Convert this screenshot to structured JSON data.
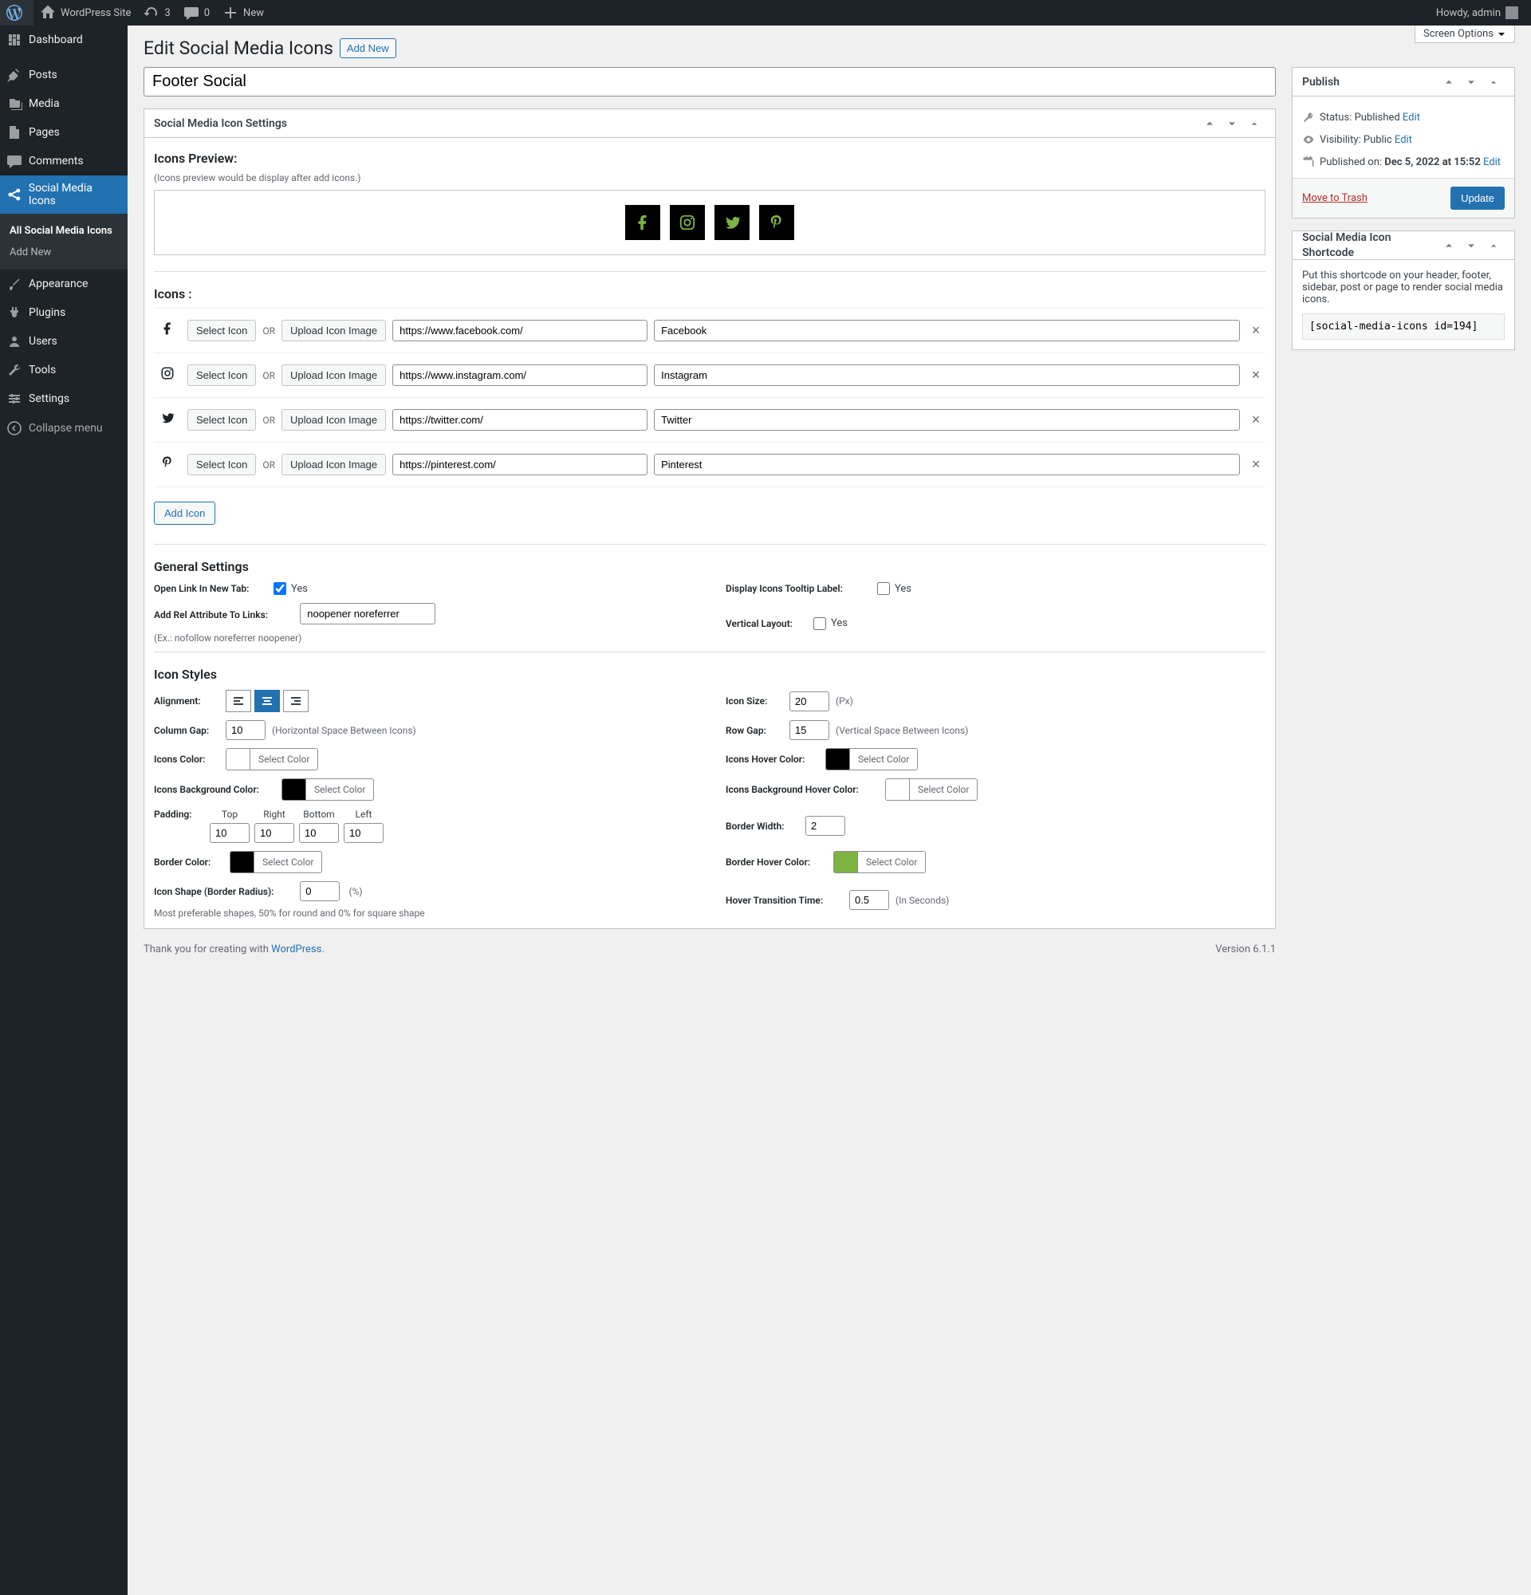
{
  "adminbar": {
    "site_name": "WordPress Site",
    "updates": "3",
    "comments": "0",
    "new": "New",
    "howdy": "Howdy, admin"
  },
  "sidebar": {
    "items": [
      {
        "label": "Dashboard"
      },
      {
        "label": "Posts"
      },
      {
        "label": "Media"
      },
      {
        "label": "Pages"
      },
      {
        "label": "Comments"
      },
      {
        "label": "Social Media Icons"
      },
      {
        "label": "Appearance"
      },
      {
        "label": "Plugins"
      },
      {
        "label": "Users"
      },
      {
        "label": "Tools"
      },
      {
        "label": "Settings"
      }
    ],
    "submenu": {
      "all": "All Social Media Icons",
      "add": "Add New"
    },
    "collapse": "Collapse menu"
  },
  "page": {
    "screen_options": "Screen Options",
    "heading": "Edit Social Media Icons",
    "add_new": "Add New",
    "title_value": "Footer Social"
  },
  "settings_panel": {
    "header": "Social Media Icon Settings",
    "preview_heading": "Icons Preview:",
    "preview_hint": "(Icons preview would be display after add icons.)",
    "icons_heading": "Icons :",
    "select_icon": "Select Icon",
    "or": "OR",
    "upload": "Upload Icon Image",
    "add_icon": "Add Icon",
    "rows": [
      {
        "icon": "facebook",
        "url": "https://www.facebook.com/",
        "title": "Facebook"
      },
      {
        "icon": "instagram",
        "url": "https://www.instagram.com/",
        "title": "Instagram"
      },
      {
        "icon": "twitter",
        "url": "https://twitter.com/",
        "title": "Twitter"
      },
      {
        "icon": "pinterest",
        "url": "https://pinterest.com/",
        "title": "Pinterest"
      }
    ]
  },
  "general": {
    "heading": "General Settings",
    "open_new_tab_label": "Open Link In New Tab:",
    "rel_label": "Add Rel Attribute To Links:",
    "rel_value": "noopener noreferrer",
    "rel_hint": "(Ex.: nofollow noreferrer noopener)",
    "tooltip_label": "Display Icons Tooltip Label:",
    "vertical_label": "Vertical Layout:",
    "yes": "Yes"
  },
  "styles": {
    "heading": "Icon Styles",
    "alignment": "Alignment:",
    "icon_size_label": "Icon Size:",
    "icon_size": "20",
    "px": "(Px)",
    "col_gap_label": "Column Gap:",
    "col_gap": "10",
    "col_gap_hint": "(Horizontal Space Between Icons)",
    "row_gap_label": "Row Gap:",
    "row_gap": "15",
    "row_gap_hint": "(Vertical Space Between Icons)",
    "icons_color_label": "Icons Color:",
    "icons_color": "#7cb342",
    "hover_color_label": "Icons Hover Color:",
    "hover_color": "#000000",
    "bg_color_label": "Icons Background Color:",
    "bg_color": "#000000",
    "bg_hover_label": "Icons Background Hover Color:",
    "bg_hover": "#ffffff",
    "select_color": "Select Color",
    "padding_label": "Padding:",
    "padding": {
      "top": "10",
      "right": "10",
      "bottom": "10",
      "left": "10"
    },
    "pad_top": "Top",
    "pad_right": "Right",
    "pad_bottom": "Bottom",
    "pad_left": "Left",
    "border_width_label": "Border Width:",
    "border_width": "2",
    "border_color_label": "Border Color:",
    "border_color": "#000000",
    "border_hover_label": "Border Hover Color:",
    "border_hover": "#7cb342",
    "shape_label": "Icon Shape (Border Radius):",
    "shape": "0",
    "percent": "(%)",
    "shape_hint": "Most preferable shapes, 50% for round and 0% for square shape",
    "transition_label": "Hover Transition Time:",
    "transition": "0.5",
    "seconds": "(In Seconds)"
  },
  "publish": {
    "header": "Publish",
    "status_label": "Status:",
    "status": "Published",
    "edit": "Edit",
    "visibility_label": "Visibility:",
    "visibility": "Public",
    "published_label": "Published on:",
    "published": "Dec 5, 2022 at 15:52",
    "trash": "Move to Trash",
    "update": "Update"
  },
  "shortcode": {
    "header": "Social Media Icon Shortcode",
    "desc": "Put this shortcode on your header, footer, sidebar, post or page to render social media icons.",
    "code": "[social-media-icons id=194]"
  },
  "footer": {
    "thanks": "Thank you for creating with ",
    "wp": "WordPress",
    "period": ".",
    "version": "Version 6.1.1"
  }
}
